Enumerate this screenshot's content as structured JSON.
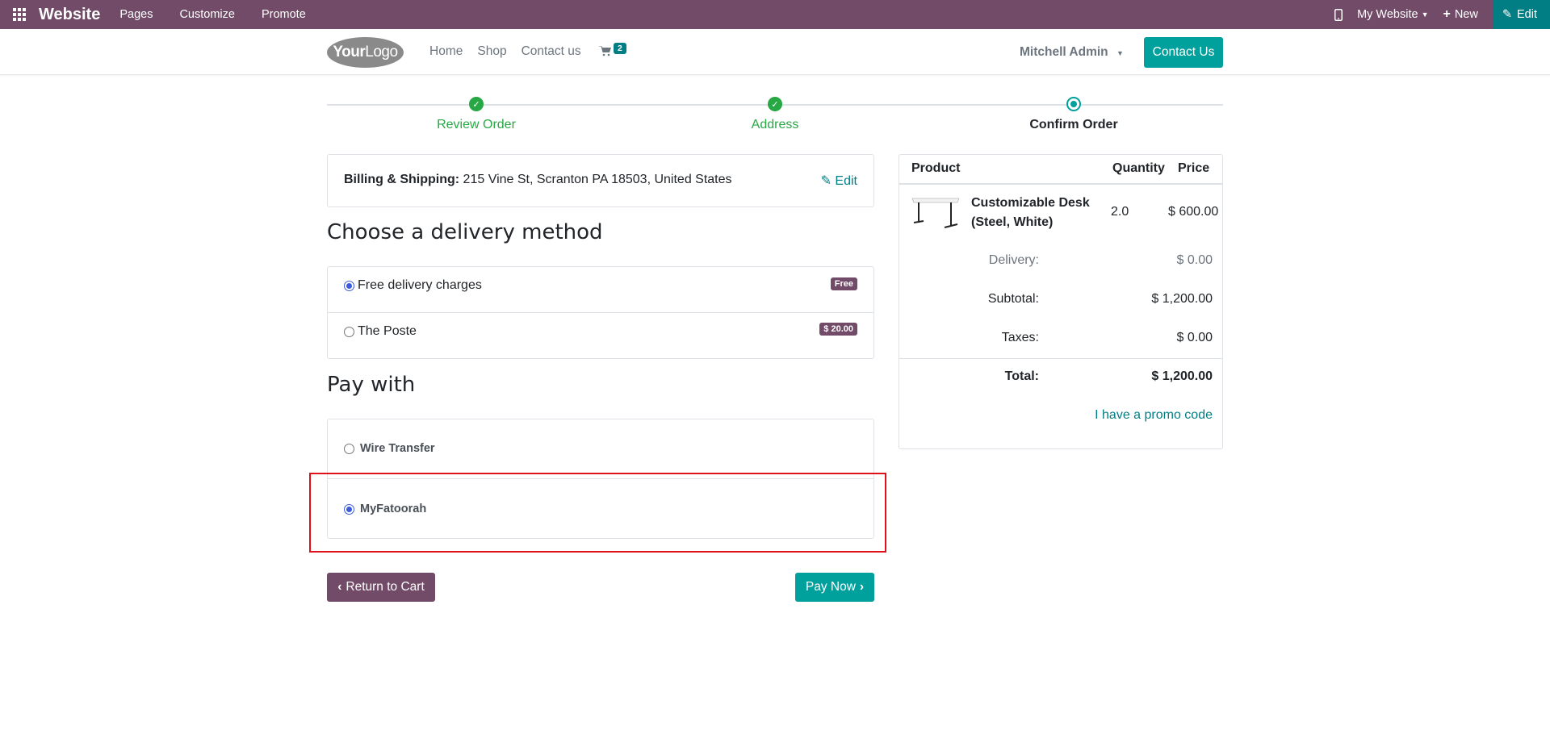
{
  "adminbar": {
    "brand": "Website",
    "menu": [
      "Pages",
      "Customize",
      "Promote"
    ],
    "site_selector": "My Website",
    "new_label": "New",
    "edit_label": "Edit"
  },
  "header": {
    "logo_text_bold": "Your",
    "logo_text": "Logo",
    "nav": [
      "Home",
      "Shop",
      "Contact us"
    ],
    "cart_count": "2",
    "user": "Mitchell Admin",
    "contact_button": "Contact Us"
  },
  "wizard": {
    "steps": [
      {
        "label": "Review Order",
        "state": "done"
      },
      {
        "label": "Address",
        "state": "done"
      },
      {
        "label": "Confirm Order",
        "state": "current"
      }
    ]
  },
  "billing": {
    "label": "Billing & Shipping:",
    "address": "215 Vine St, Scranton PA 18503, United States",
    "edit_label": "Edit"
  },
  "delivery": {
    "heading": "Choose a delivery method",
    "options": [
      {
        "label": "Free delivery charges",
        "badge": "Free",
        "selected": true
      },
      {
        "label": "The Poste",
        "badge": "$ 20.00",
        "selected": false
      }
    ]
  },
  "payment": {
    "heading": "Pay with",
    "options": [
      {
        "label": "Wire Transfer",
        "selected": false
      },
      {
        "label": "MyFatoorah",
        "selected": true
      }
    ]
  },
  "buttons": {
    "return": "Return to Cart",
    "pay": "Pay Now"
  },
  "summary": {
    "headers": {
      "product": "Product",
      "quantity": "Quantity",
      "price": "Price"
    },
    "item": {
      "name_line1": "Customizable Desk",
      "name_line2": "(Steel, White)",
      "quantity": "2.0",
      "price": "$ 600.00"
    },
    "delivery_label": "Delivery:",
    "delivery_value": "$ 0.00",
    "subtotal_label": "Subtotal:",
    "subtotal_value": "$ 1,200.00",
    "taxes_label": "Taxes:",
    "taxes_value": "$ 0.00",
    "total_label": "Total:",
    "total_value": "$ 1,200.00",
    "promo": "I have a promo code"
  },
  "colors": {
    "admin_bar": "#714b67",
    "accent": "#00a09d",
    "success": "#28a745",
    "highlight_border": "#e0101a"
  }
}
